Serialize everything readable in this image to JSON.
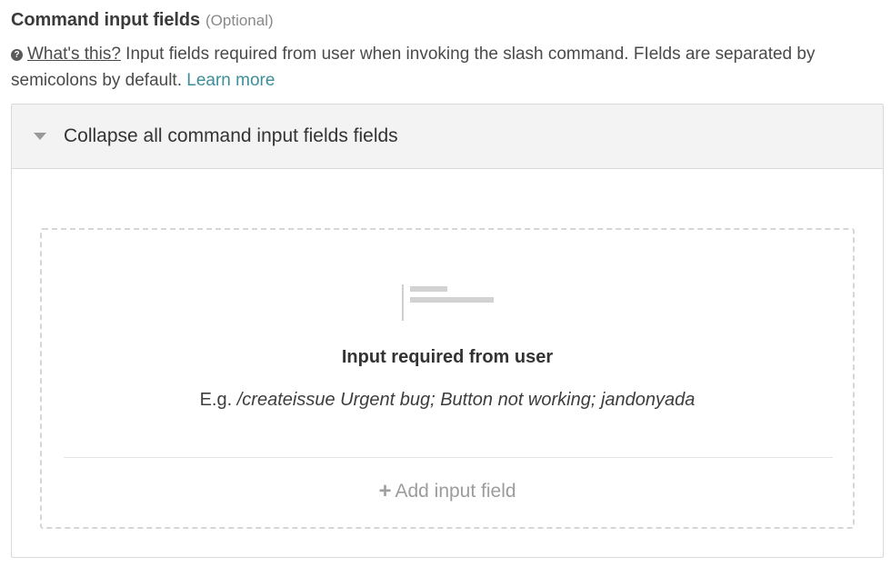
{
  "section": {
    "title": "Command input fields",
    "optional": "(Optional)"
  },
  "help": {
    "icon": "question-circle-icon",
    "whats_this": "What's this?",
    "description": "Input fields required from user when invoking the slash command. FIelds are separated by semicolons by default.",
    "learn_more": "Learn more"
  },
  "panel": {
    "caret_icon": "caret-down-icon",
    "collapse_label": "Collapse all command input fields fields"
  },
  "empty_state": {
    "illustration": "input-field-illustration",
    "title": "Input required from user",
    "example_prefix": "E.g.",
    "example_command": "/createissue Urgent bug; Button not working; jandonyada",
    "add_icon": "plus-icon",
    "add_label": "Add input field"
  },
  "colors": {
    "link": "#3c8f9a",
    "panel_header_bg": "#f3f3f3",
    "dashed_border": "#d6d6d6",
    "muted_text": "#9c9c9c"
  }
}
